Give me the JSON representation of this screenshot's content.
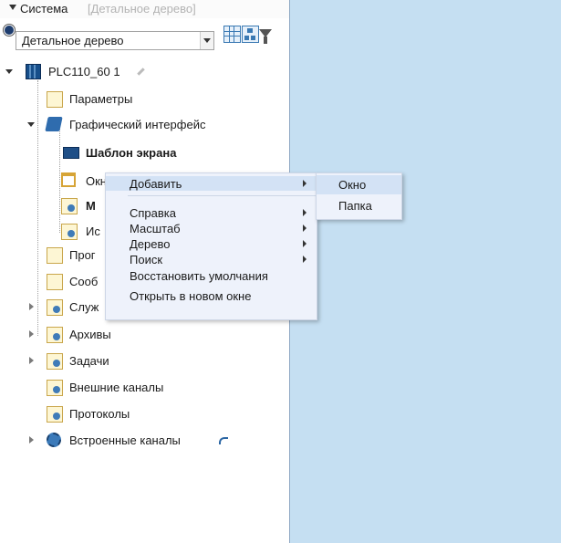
{
  "header": {
    "title": "Система",
    "hint": "[Детальное дерево]"
  },
  "toolbar": {
    "view_selected": "Детальное дерево",
    "icons": [
      "eye-icon",
      "table-view-icon",
      "tree-view-icon",
      "filter-icon"
    ]
  },
  "tree": {
    "root": "PLC110_60 1",
    "items": [
      "Параметры",
      "Графический интерфейс",
      "Шаблон экрана",
      "Окна",
      "М",
      "Ис",
      "Прог",
      "Сооб",
      "Служ",
      "Архивы",
      "Задачи",
      "Внешние каналы",
      "Протоколы",
      "Встроенные каналы"
    ]
  },
  "context_menu": {
    "items": [
      "Добавить",
      "Справка",
      "Масштаб",
      "Дерево",
      "Поиск",
      "Восстановить умолчания",
      "Открыть в новом окне"
    ]
  },
  "submenu": {
    "items": [
      "Окно",
      "Папка"
    ]
  },
  "colors": {
    "panel_bg": "#c5dff2",
    "menu_bg": "#eef2fb",
    "highlight": "#d3e2f5"
  }
}
